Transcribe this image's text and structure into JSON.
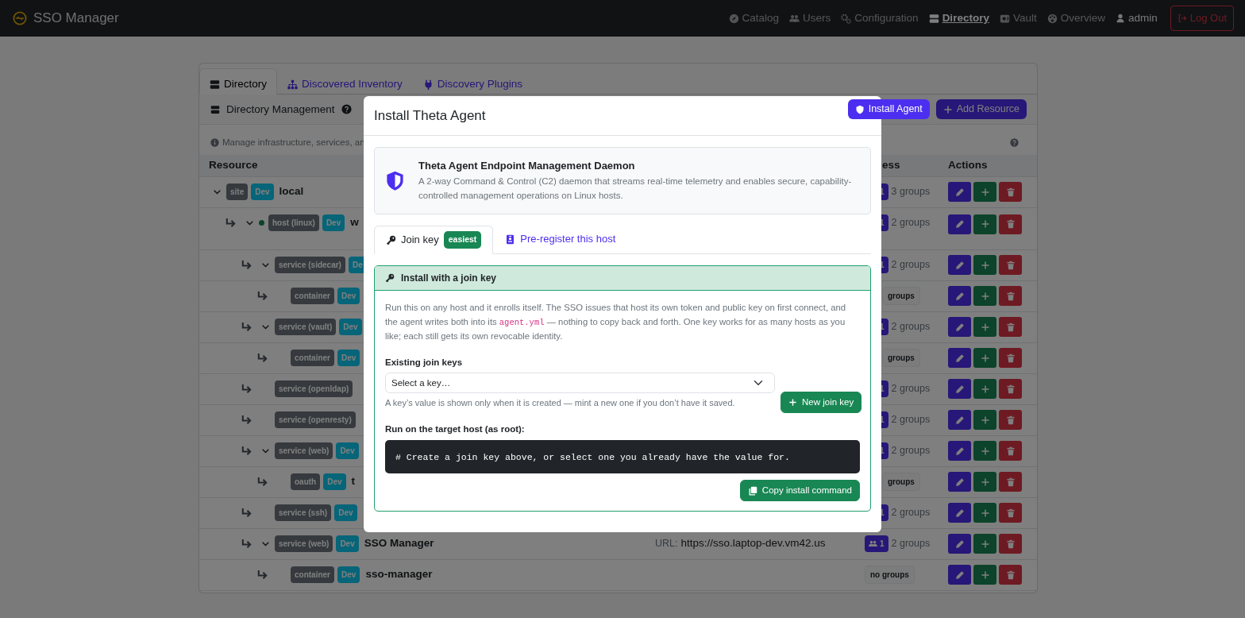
{
  "navbar": {
    "brand": "SSO Manager",
    "links": [
      {
        "label": "Catalog",
        "selected": false
      },
      {
        "label": "Users",
        "selected": false
      },
      {
        "label": "Configuration",
        "selected": false
      },
      {
        "label": "Directory",
        "selected": true
      },
      {
        "label": "Vault",
        "selected": false
      },
      {
        "label": "Overview",
        "selected": false
      }
    ],
    "user": "admin",
    "logout": "Log Out"
  },
  "page_tabs": [
    {
      "label": "Directory",
      "selected": true
    },
    {
      "label": "Discovered Inventory",
      "selected": false
    },
    {
      "label": "Discovery Plugins",
      "selected": false
    }
  ],
  "section": {
    "title": "Directory Management",
    "install_button": "Install Agent",
    "add_button": "Add Resource",
    "info": "Manage infrastructure, services, an"
  },
  "table": {
    "columns": [
      {
        "label": "Resource"
      },
      {
        "label": "ess"
      },
      {
        "label": "Actions"
      }
    ],
    "rows": [
      {
        "type": "site",
        "env": "Dev",
        "name": "local",
        "access": "1",
        "groups": "3 groups",
        "expanded": true,
        "children": [
          {
            "type": "host (linux)",
            "env": "Dev",
            "name": "w",
            "online": true,
            "access": "1",
            "groups": "2 groups",
            "expanded": true,
            "children": [
              {
                "type": "service (sidecar)",
                "env": "De",
                "access": "1",
                "groups": "2 groups",
                "expanded": true,
                "children": [
                  {
                    "type": "container",
                    "env": "Dev",
                    "groups": "groups"
                  }
                ]
              },
              {
                "type": "service (vault)",
                "env": "Dev",
                "access": "1",
                "groups": "2 groups",
                "expanded": true,
                "children": [
                  {
                    "type": "container",
                    "env": "Dev",
                    "groups": "groups"
                  }
                ]
              },
              {
                "type": "service (openldap)",
                "access": "1",
                "groups": "2 groups"
              },
              {
                "type": "service (openresty)",
                "access": "1",
                "groups": "2 groups"
              },
              {
                "type": "service (web)",
                "env": "Dev",
                "access": "1",
                "groups": "2 groups",
                "expanded": true,
                "children": [
                  {
                    "type": "oauth",
                    "env": "Dev",
                    "name": "t",
                    "groups": "groups"
                  }
                ]
              },
              {
                "type": "service (ssh)",
                "env": "Dev",
                "access": "1",
                "groups": "2 groups"
              },
              {
                "type": "service (web)",
                "env": "Dev",
                "name": "SSO Manager",
                "url_label": "URL:",
                "url": "https://sso.laptop-dev.vm42.us",
                "access": "1",
                "groups": "2 groups",
                "expanded": true,
                "children": [
                  {
                    "type": "container",
                    "env": "Dev",
                    "name": "sso-manager",
                    "groups": "no groups"
                  }
                ]
              }
            ]
          }
        ]
      }
    ]
  },
  "modal": {
    "title": "Install Theta Agent",
    "intro": {
      "title": "Theta Agent Endpoint Management Daemon",
      "text": "A 2-way Command & Control (C2) daemon that streams real-time telemetry and enables secure, capability-controlled management operations on Linux hosts."
    },
    "tabs": [
      {
        "label": "Join key",
        "badge": "easiest",
        "selected": true
      },
      {
        "label": "Pre-register this host",
        "selected": false
      }
    ],
    "panel": {
      "title": "Install with a join key",
      "text": [
        {
          "kind": "text",
          "value": "Run this on any host and it enrolls itself. The SSO issues that host its own token and public key on first connect, and the agent writes both into its "
        },
        {
          "kind": "code",
          "value": "agent.yml"
        },
        {
          "kind": "text",
          "value": " — nothing to copy back and forth. One key works for as many hosts as you like; each still gets its own revocable identity."
        }
      ],
      "keys_label": "Existing join keys",
      "select_value": "Select a key…",
      "hint": "A key’s value is shown only when it is created — mint a new one if you don’t have it saved.",
      "new_key_button": "New join key",
      "command_label": "Run on the target host (as root):",
      "command": "# Create a join key above, or select one you already have the value for.",
      "copy_button": "Copy install command"
    }
  }
}
